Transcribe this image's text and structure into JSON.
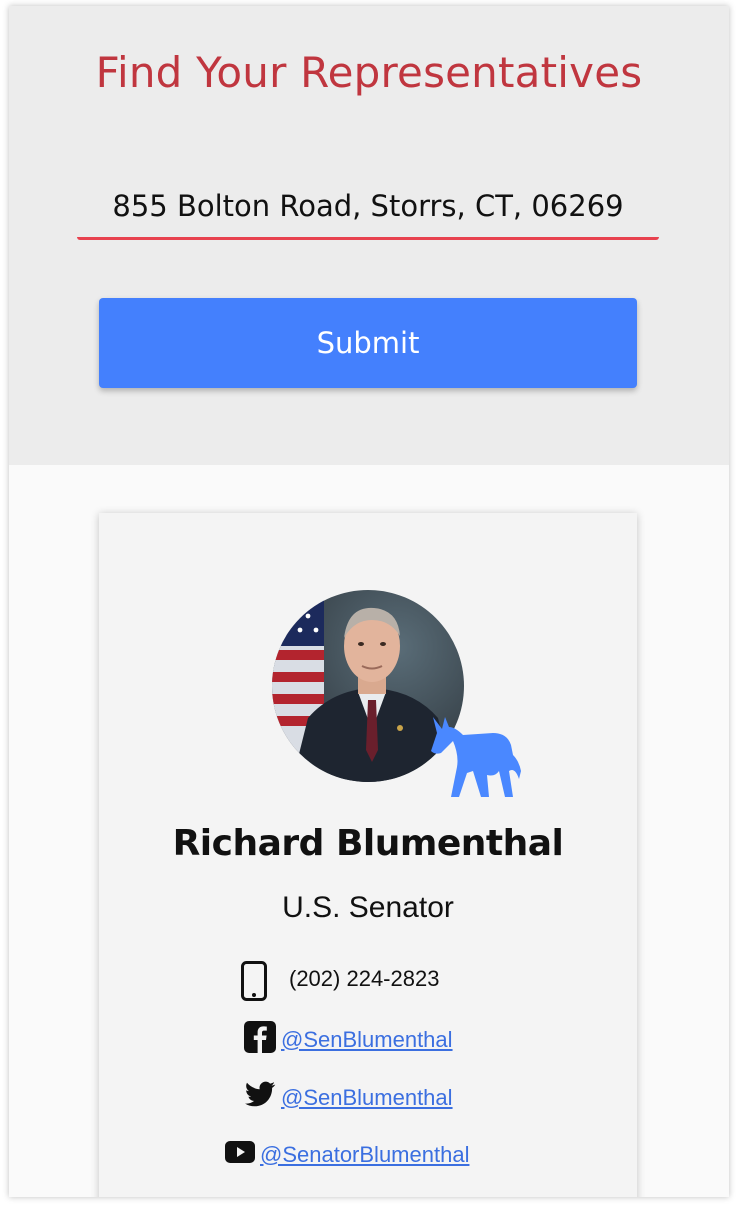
{
  "search": {
    "title": "Find Your Representatives",
    "address_value": "855 Bolton Road, Storrs, CT, 06269",
    "submit_label": "Submit"
  },
  "representative": {
    "name": "Richard Blumenthal",
    "office": "U.S. Senator",
    "party_icon": "democrat-donkey-icon",
    "phone": "(202) 224-2823",
    "facebook": "@SenBlumenthal",
    "twitter": "@SenBlumenthal",
    "youtube": "@SenatorBlumenthal"
  },
  "colors": {
    "title": "#c0363f",
    "input_underline": "#e8424f",
    "submit_bg": "#4480fd",
    "party_blue": "#4a88ff",
    "link": "#3b6fe0"
  }
}
